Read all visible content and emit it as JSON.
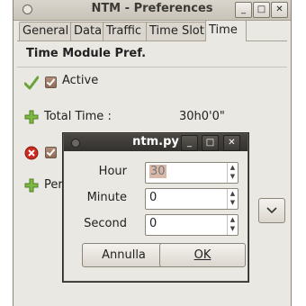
{
  "window": {
    "title": "NTM - Preferences",
    "buttons": {
      "minimize": "_",
      "maximize": "□",
      "close": "✕"
    }
  },
  "tabs": [
    {
      "label": "General"
    },
    {
      "label": "Data"
    },
    {
      "label": "Traffic"
    },
    {
      "label": "Time Slot"
    },
    {
      "label": "Time",
      "active": true
    }
  ],
  "pane": {
    "section_title": "Time Module Pref.",
    "active_label": "Active",
    "total_time_label": "Total Time :",
    "total_time_value": "30h0'0\"",
    "period_label": "Per"
  },
  "dialog": {
    "title": "ntm.py",
    "fields": [
      {
        "label": "Hour",
        "value": "30",
        "selected": true
      },
      {
        "label": "Minute",
        "value": "0"
      },
      {
        "label": "Second",
        "value": "0"
      }
    ],
    "cancel_label": "Annulla",
    "ok_label": "OK"
  },
  "colors": {
    "accent_green": "#6aa33a",
    "close_red": "#cc2a1e",
    "checkbox": "#9c7560"
  }
}
